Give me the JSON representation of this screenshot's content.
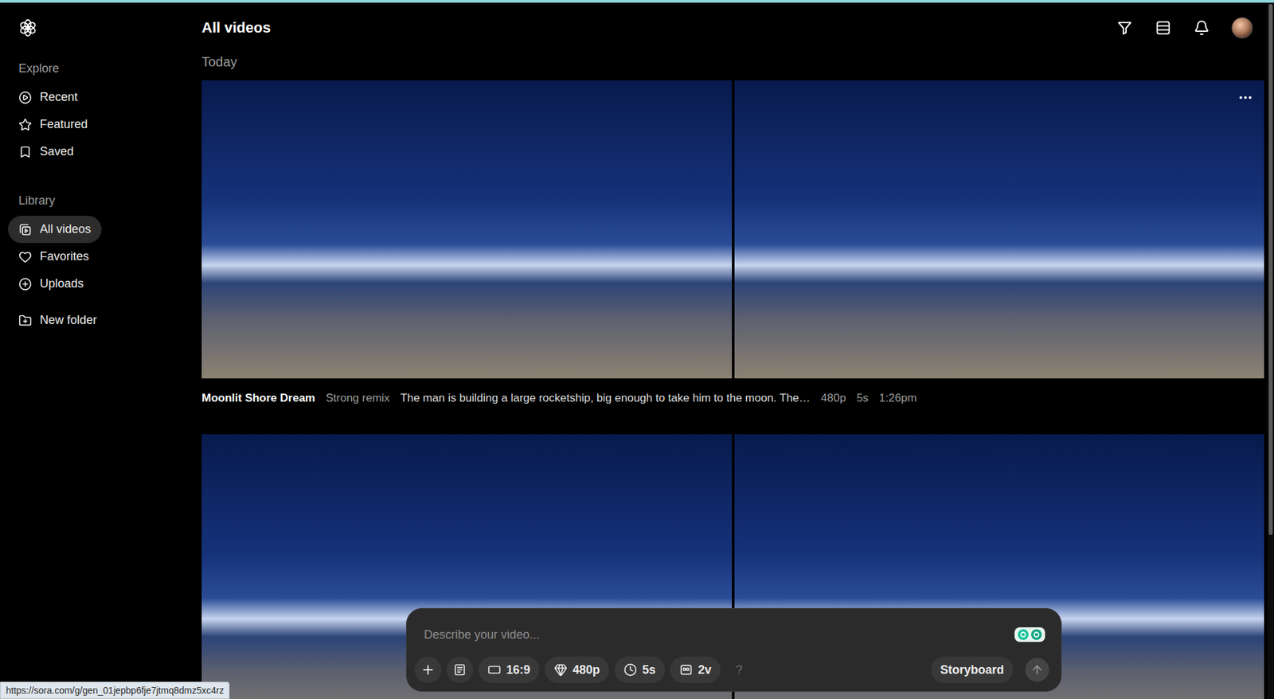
{
  "header": {
    "title": "All videos"
  },
  "sidebar": {
    "sections": [
      {
        "title": "Explore",
        "items": [
          {
            "label": "Recent",
            "selected": false
          },
          {
            "label": "Featured",
            "selected": false
          },
          {
            "label": "Saved",
            "selected": false
          }
        ]
      },
      {
        "title": "Library",
        "items": [
          {
            "label": "All videos",
            "selected": true
          },
          {
            "label": "Favorites",
            "selected": false
          },
          {
            "label": "Uploads",
            "selected": false
          }
        ]
      }
    ],
    "new_folder": {
      "label": "New folder"
    }
  },
  "groups": [
    {
      "title": "Today",
      "generations": [
        {
          "caption": {
            "title": "Moonlit Shore Dream",
            "tag": "Strong remix",
            "prompt": "The man is building a large rocketship, big enough to take him to the moon. The…",
            "resolution": "480p",
            "duration": "5s",
            "time": "1:26pm"
          },
          "frames": [
            {
              "menu_visible": false
            },
            {
              "menu_visible": true
            }
          ]
        },
        {
          "frames": [
            {
              "menu_visible": false
            },
            {
              "menu_visible": false
            }
          ]
        }
      ]
    }
  ],
  "composer": {
    "placeholder": "Describe your video...",
    "settings": [
      {
        "label": "16:9"
      },
      {
        "label": "480p"
      },
      {
        "label": "5s"
      },
      {
        "label": "2v"
      }
    ],
    "help": "?",
    "storyboard": "Storyboard"
  },
  "status_bar": {
    "url": "https://sora.com/g/gen_01jepbp6fje7jtmq8dmz5xc4rz"
  }
}
